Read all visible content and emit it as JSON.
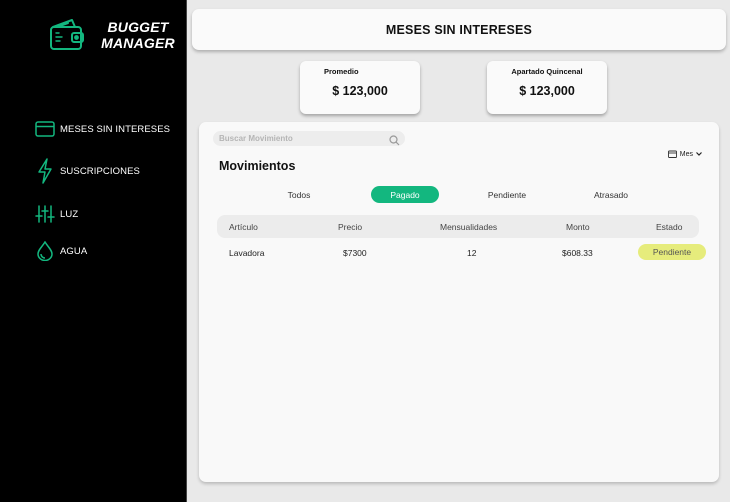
{
  "app": {
    "brand_line1": "BUGGET",
    "brand_line2": "MANAGER",
    "accent": "#13b77f",
    "badge_color": "#e6ec7c"
  },
  "sidebar": {
    "items": [
      {
        "label": "MESES SIN INTERESES",
        "icon": "card-icon"
      },
      {
        "label": "SUSCRIPCIONES",
        "icon": "lightning-icon"
      },
      {
        "label": "LUZ",
        "icon": "sliders-icon"
      },
      {
        "label": "AGUA",
        "icon": "water-drop-icon"
      }
    ]
  },
  "header": {
    "title": "MESES SIN INTERESES"
  },
  "stats": [
    {
      "label": "Promedio",
      "value": "$ 123,000"
    },
    {
      "label": "Apartado Quincenal",
      "value": "$ 123,000"
    }
  ],
  "panel": {
    "search_placeholder": "Buscar Movimiento",
    "month_label": "Mes",
    "title": "Movimientos",
    "tabs": [
      {
        "label": "Todos",
        "active": false
      },
      {
        "label": "Pagado",
        "active": true
      },
      {
        "label": "Pendiente",
        "active": false
      },
      {
        "label": "Atrasado",
        "active": false
      }
    ],
    "columns": [
      "Artículo",
      "Precio",
      "Mensualidades",
      "Monto",
      "Estado"
    ],
    "rows": [
      {
        "articulo": "Lavadora",
        "precio": "$7300",
        "mensualidades": "12",
        "monto": "$608.33",
        "estado": "Pendiente"
      }
    ]
  }
}
